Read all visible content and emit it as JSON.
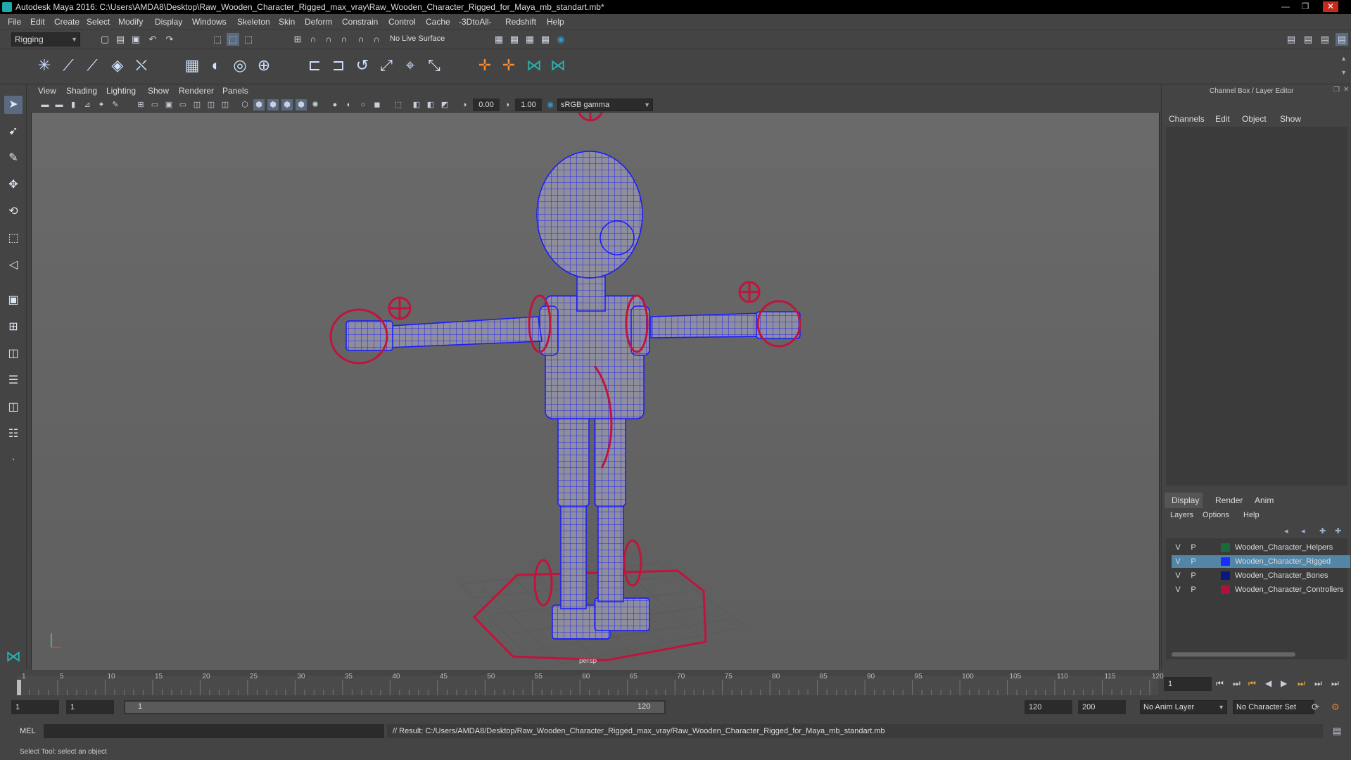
{
  "window": {
    "title": "Autodesk Maya 2016: C:\\Users\\AMDA8\\Desktop\\Raw_Wooden_Character_Rigged_max_vray\\Raw_Wooden_Character_Rigged_for_Maya_mb_standart.mb*",
    "minimize": "—",
    "maximize": "❐",
    "close": "✕"
  },
  "menubar": [
    "File",
    "Edit",
    "Create",
    "Select",
    "Modify",
    "Display",
    "Windows",
    "Skeleton",
    "Skin",
    "Deform",
    "Constrain",
    "Control",
    "Cache",
    "-3DtoAll-",
    "Redshift",
    "Help"
  ],
  "statusline": {
    "menuset": "Rigging",
    "live_surface": "No Live Surface"
  },
  "viewport": {
    "menus": [
      "View",
      "Shading",
      "Lighting",
      "Show",
      "Renderer",
      "Panels"
    ],
    "exposure": "0.00",
    "gamma": "1.00",
    "color_space": "sRGB gamma",
    "camera_label": "persp"
  },
  "channel_box": {
    "title": "Channel Box / Layer Editor",
    "menus": [
      "Channels",
      "Edit",
      "Object",
      "Show"
    ]
  },
  "layer_editor": {
    "tabs": [
      "Display",
      "Render",
      "Anim"
    ],
    "active_tab": "Display",
    "menus": [
      "Layers",
      "Options",
      "Help"
    ],
    "layers": [
      {
        "v": "V",
        "p": "P",
        "color": "#1a6b3a",
        "name": "Wooden_Character_Helpers",
        "selected": false
      },
      {
        "v": "V",
        "p": "P",
        "color": "#1a2cff",
        "name": "Wooden_Character_Rigged",
        "selected": true
      },
      {
        "v": "V",
        "p": "P",
        "color": "#0d1780",
        "name": "Wooden_Character_Bones",
        "selected": false
      },
      {
        "v": "V",
        "p": "P",
        "color": "#b0113a",
        "name": "Wooden_Character_Controllers",
        "selected": false
      }
    ]
  },
  "timeline": {
    "ticks": [
      "1",
      "5",
      "10",
      "15",
      "20",
      "25",
      "30",
      "35",
      "40",
      "45",
      "50",
      "55",
      "60",
      "65",
      "70",
      "75",
      "80",
      "85",
      "90",
      "95",
      "100",
      "105",
      "110",
      "115",
      "120"
    ],
    "current_frame": "1"
  },
  "range": {
    "start": "1",
    "playback_start": "1",
    "slider_start": "1",
    "slider_end": "120",
    "playback_end": "120",
    "end": "200",
    "anim_layer": "No Anim Layer",
    "character_set": "No Character Set"
  },
  "command": {
    "language": "MEL",
    "result": "// Result: C:/Users/AMDA8/Desktop/Raw_Wooden_Character_Rigged_max_vray/Raw_Wooden_Character_Rigged_for_Maya_mb_standart.mb"
  },
  "help_line": "Select Tool: select an object",
  "colors": {
    "wire": "#1a1aff",
    "controller": "#c0143c",
    "selection": "#5285a6"
  }
}
